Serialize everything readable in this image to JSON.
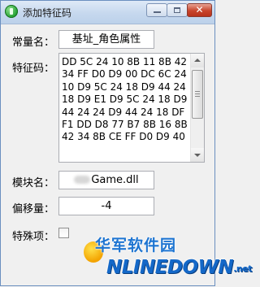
{
  "window": {
    "title": "添加特征码",
    "controls": {
      "minimize": "minimize",
      "maximize": "maximize",
      "close": "✕"
    }
  },
  "form": {
    "constant_label": "常量名：",
    "constant_value": "基址_角色属性",
    "signature_label": "特征码：",
    "signature_value": "DD 5C 24 10 8B 11 8B 42 34 FF D0 D9 00 DC 6C 24 10 D9 5C 24 18 D9 44 24 18 D9 E1 D9 5C 24 18 D9 44 24 24 D9 44 24 18 DF F1 DD D8 77 B7 8B 16 8B 42 34 8B CE FF D0 D9 40",
    "module_label": "模块名：",
    "module_value": "Game.dll",
    "offset_label": "偏移量：",
    "offset_value": "-4",
    "special_label": "特殊项："
  },
  "watermark": {
    "chinese": "华军软件园",
    "english": "NLINEDOWN",
    "suffix": ".net"
  }
}
